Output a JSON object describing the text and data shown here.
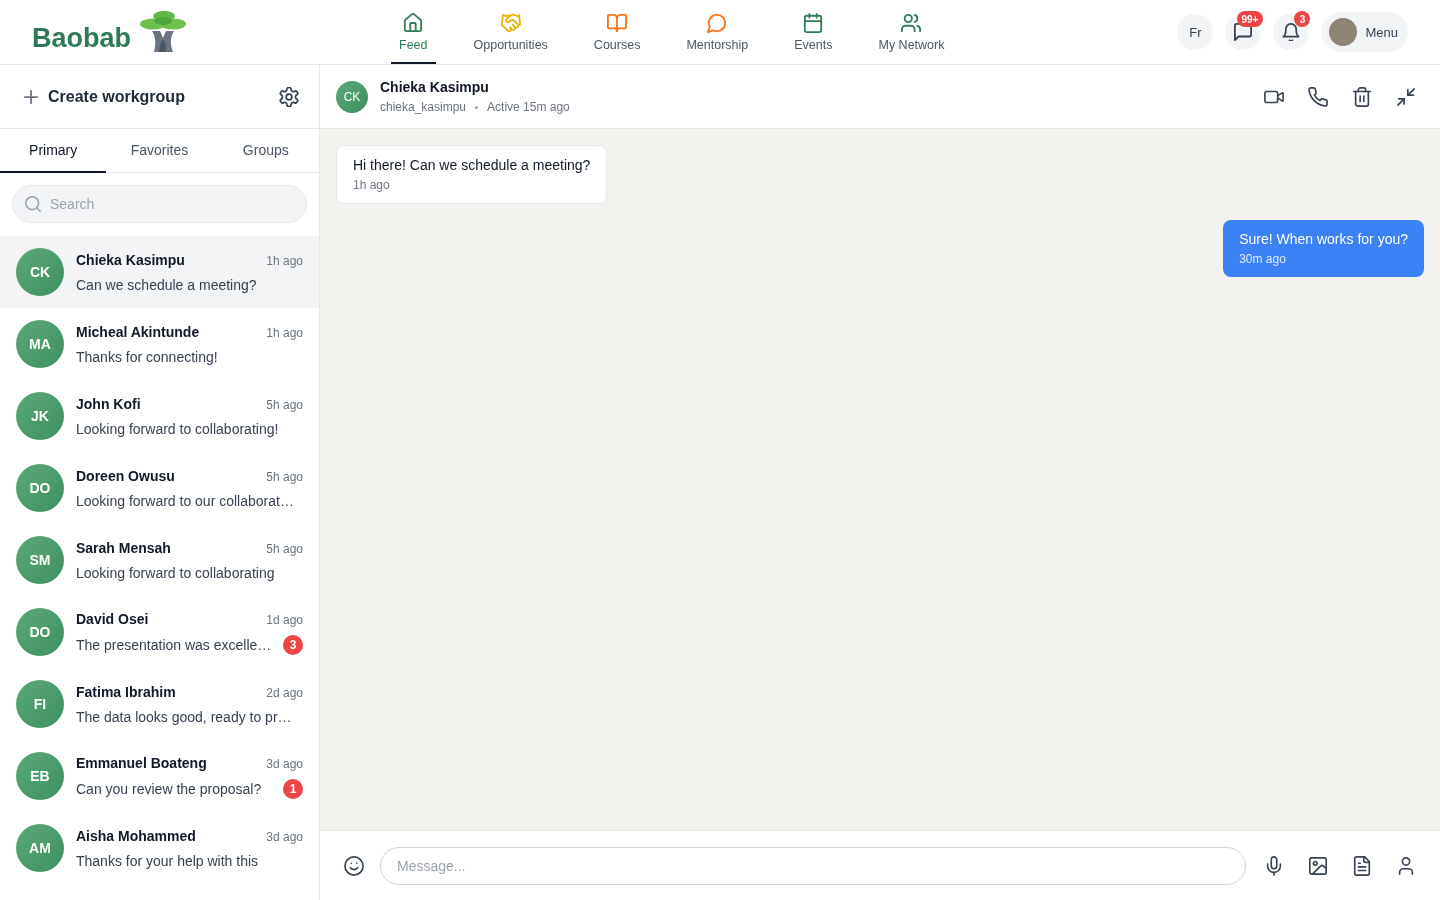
{
  "header": {
    "logo": {
      "text": "Baobab"
    },
    "nav": [
      {
        "label": "Feed",
        "color": "#2f7d57",
        "selected": true
      },
      {
        "label": "Opportunities",
        "color": "#eab308",
        "selected": false
      },
      {
        "label": "Courses",
        "color": "#f97316",
        "selected": false
      },
      {
        "label": "Mentorship",
        "color": "#f97316",
        "selected": false
      },
      {
        "label": "Events",
        "color": "#2f7d57",
        "selected": false
      },
      {
        "label": "My Network",
        "color": "#2f7d57",
        "selected": false
      }
    ],
    "language": "Fr",
    "messages_badge": "99+",
    "notifications_badge": "3",
    "menu": {
      "label": "Menu"
    }
  },
  "sidebar": {
    "create_label": "Create workgroup",
    "tabs": [
      {
        "label": "Primary",
        "selected": true
      },
      {
        "label": "Favorites",
        "selected": false
      },
      {
        "label": "Groups",
        "selected": false
      }
    ],
    "search": {
      "placeholder": "Search"
    },
    "conversations": [
      {
        "initials": "CK",
        "name": "Chieka Kasimpu",
        "time": "1h ago",
        "preview": "Can we schedule a meeting?",
        "selected": true
      },
      {
        "initials": "MA",
        "name": "Micheal Akintunde",
        "time": "1h ago",
        "preview": "Thanks for connecting!",
        "selected": false
      },
      {
        "initials": "JK",
        "name": "John Kofi",
        "time": "5h ago",
        "preview": "Looking forward to collaborating!",
        "selected": false
      },
      {
        "initials": "DO",
        "name": "Doreen Owusu",
        "time": "5h ago",
        "preview": "Looking forward to our collaborat…",
        "selected": false
      },
      {
        "initials": "SM",
        "name": "Sarah Mensah",
        "time": "5h ago",
        "preview": "Looking forward to collaborating",
        "selected": false
      },
      {
        "initials": "DO",
        "name": "David Osei",
        "time": "1d ago",
        "preview": "The presentation was excelle…",
        "unread": "3",
        "selected": false
      },
      {
        "initials": "FI",
        "name": "Fatima Ibrahim",
        "time": "2d ago",
        "preview": "The data looks good, ready to pr…",
        "selected": false
      },
      {
        "initials": "EB",
        "name": "Emmanuel Boateng",
        "time": "3d ago",
        "preview": "Can you review the proposal?",
        "unread": "1",
        "selected": false
      },
      {
        "initials": "AM",
        "name": "Aisha Mohammed",
        "time": "3d ago",
        "preview": "Thanks for your help with this",
        "selected": false
      }
    ]
  },
  "chat": {
    "contact": {
      "initials": "CK",
      "name": "Chieka Kasimpu",
      "username": "chieka_kasimpu",
      "status": "Active 15m ago"
    },
    "messages": [
      {
        "kind": "received",
        "text": "Hi there! Can we schedule a meeting?",
        "time": "1h ago"
      },
      {
        "kind": "sent",
        "text": "Sure! When works for you?",
        "time": "30m ago"
      }
    ],
    "composer": {
      "placeholder": "Message..."
    }
  }
}
